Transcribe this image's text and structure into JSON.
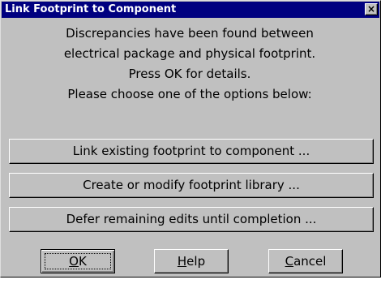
{
  "window": {
    "title": "Link Footprint to Component",
    "close_glyph": "×"
  },
  "message": {
    "lines": [
      "Discrepancies have been found between",
      "electrical package and physical footprint.",
      "Press OK for details.",
      "Please choose one of the options below:"
    ]
  },
  "options": {
    "link_existing": "Link existing footprint to component ...",
    "create_modify": "Create or modify footprint library ...",
    "defer_edits": "Defer remaining edits until completion ..."
  },
  "buttons": {
    "ok": {
      "mnemonic": "O",
      "rest": "K"
    },
    "help": {
      "mnemonic": "H",
      "rest": "elp"
    },
    "cancel": {
      "mnemonic": "C",
      "rest": "ancel"
    }
  },
  "colors": {
    "title_bar": "#000080",
    "face": "#c0c0c0"
  }
}
